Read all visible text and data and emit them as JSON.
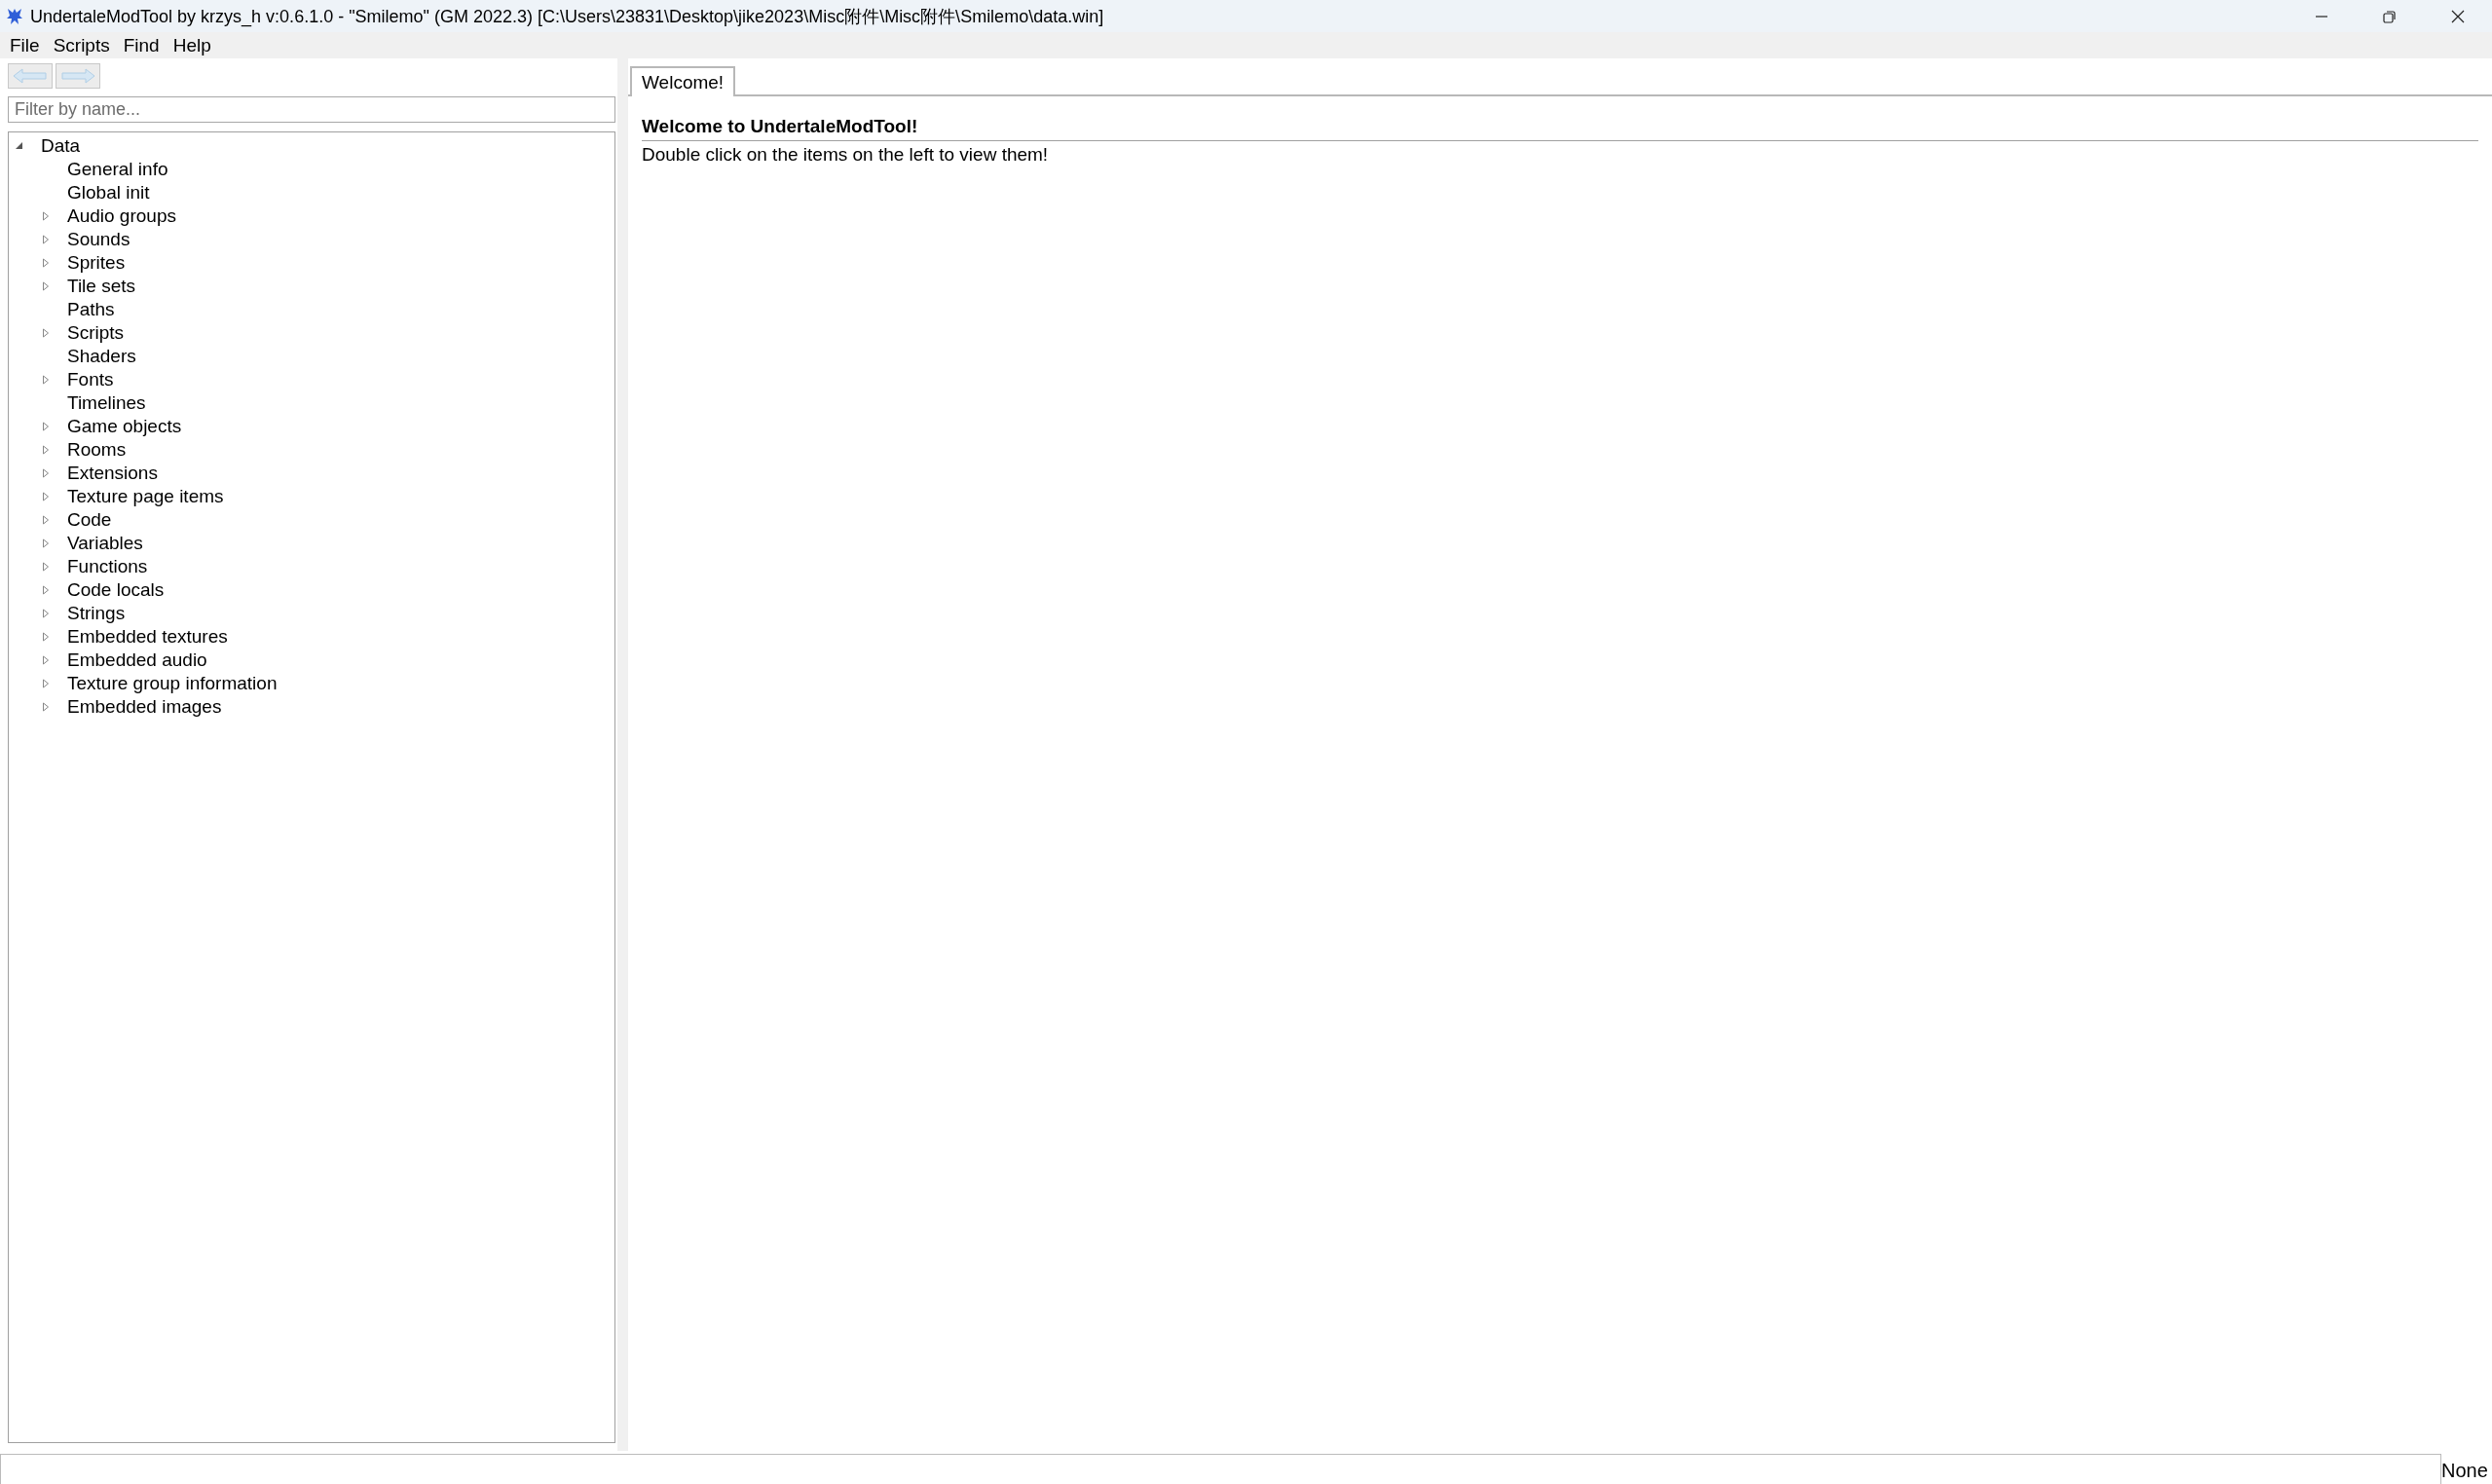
{
  "window": {
    "title": "UndertaleModTool by krzys_h v:0.6.1.0 - \"Smilemo\" (GM 2022.3) [C:\\Users\\23831\\Desktop\\jike2023\\Misc附件\\Misc附件\\Smilemo\\data.win]"
  },
  "menu": [
    "File",
    "Scripts",
    "Find",
    "Help"
  ],
  "navigation": {
    "back_disabled": true,
    "forward_disabled": true
  },
  "filter": {
    "placeholder": "Filter by name..."
  },
  "tree": [
    {
      "label": "Data",
      "expanded": true,
      "children": [
        {
          "label": "General info",
          "kind": "leaf"
        },
        {
          "label": "Global init",
          "kind": "leaf"
        },
        {
          "label": "Audio groups",
          "kind": "collapsed"
        },
        {
          "label": "Sounds",
          "kind": "collapsed"
        },
        {
          "label": "Sprites",
          "kind": "collapsed"
        },
        {
          "label": "Tile sets",
          "kind": "collapsed"
        },
        {
          "label": "Paths",
          "kind": "leaf"
        },
        {
          "label": "Scripts",
          "kind": "collapsed"
        },
        {
          "label": "Shaders",
          "kind": "leaf"
        },
        {
          "label": "Fonts",
          "kind": "collapsed"
        },
        {
          "label": "Timelines",
          "kind": "leaf"
        },
        {
          "label": "Game objects",
          "kind": "collapsed"
        },
        {
          "label": "Rooms",
          "kind": "collapsed"
        },
        {
          "label": "Extensions",
          "kind": "collapsed"
        },
        {
          "label": "Texture page items",
          "kind": "collapsed"
        },
        {
          "label": "Code",
          "kind": "collapsed"
        },
        {
          "label": "Variables",
          "kind": "collapsed"
        },
        {
          "label": "Functions",
          "kind": "collapsed"
        },
        {
          "label": "Code locals",
          "kind": "collapsed"
        },
        {
          "label": "Strings",
          "kind": "collapsed"
        },
        {
          "label": "Embedded textures",
          "kind": "collapsed"
        },
        {
          "label": "Embedded audio",
          "kind": "collapsed"
        },
        {
          "label": "Texture group information",
          "kind": "collapsed"
        },
        {
          "label": "Embedded images",
          "kind": "collapsed"
        }
      ]
    }
  ],
  "tabs": [
    {
      "label": "Welcome!",
      "selected": true
    }
  ],
  "welcome": {
    "heading": "Welcome to UndertaleModTool!",
    "text": "Double click on the items on the left to view them!"
  },
  "status_bar": {
    "text": "None"
  }
}
